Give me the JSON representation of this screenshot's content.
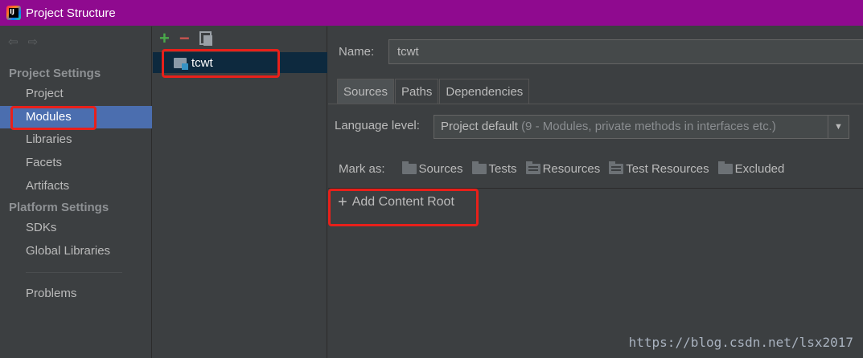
{
  "window": {
    "title": "Project Structure"
  },
  "left_nav": {
    "back_glyph": "⇦",
    "forward_glyph": "⇨",
    "project_settings_header": "Project Settings",
    "project_settings": [
      "Project",
      "Modules",
      "Libraries",
      "Facets",
      "Artifacts"
    ],
    "platform_settings_header": "Platform Settings",
    "platform_settings": [
      "SDKs",
      "Global Libraries"
    ],
    "problems": "Problems",
    "selected": "Modules"
  },
  "modules": {
    "add": "+",
    "remove": "−",
    "list": [
      "tcwt"
    ]
  },
  "module_detail": {
    "name_label": "Name:",
    "name_value": "tcwt",
    "tabs": [
      "Sources",
      "Paths",
      "Dependencies"
    ],
    "active_tab": "Sources",
    "language_level_label": "Language level:",
    "language_level_value": "Project default",
    "language_level_hint": "(9 - Modules, private methods in interfaces etc.)",
    "dropdown_arrow": "▼",
    "mark_as_label": "Mark as:",
    "mark_as": [
      "Sources",
      "Tests",
      "Resources",
      "Test Resources",
      "Excluded"
    ],
    "add_content_root": "Add Content Root",
    "add_glyph": "+"
  },
  "watermark": "https://blog.csdn.net/lsx2017",
  "colors": {
    "titlebar": "#8f0a8f",
    "selection": "#4b6eaf",
    "highlight": "#e8201a"
  }
}
